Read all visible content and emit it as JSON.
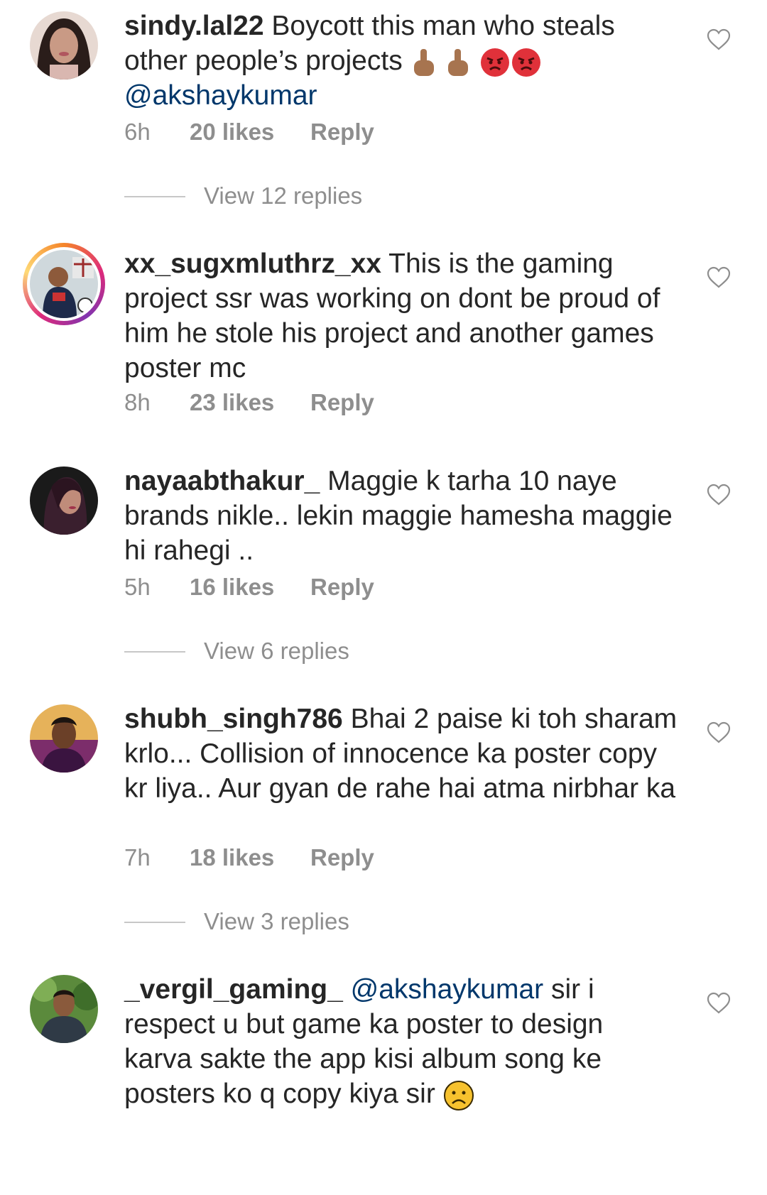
{
  "comments": [
    {
      "username": "sindy.lal22",
      "mention": "",
      "text": "Boycott this man who steals other people’s projects",
      "mention_after": "@akshaykumar",
      "time": "6h",
      "likes": "20 likes",
      "reply": "Reply",
      "view_replies": "View 12 replies"
    },
    {
      "username": "xx_sugxmluthrz_xx",
      "mention": "",
      "text": "This is the gaming project ssr was working on dont be proud of him he stole his project and another games poster mc",
      "time": "8h",
      "likes": "23 likes",
      "reply": "Reply",
      "view_replies": ""
    },
    {
      "username": "nayaabthakur_",
      "mention": "",
      "text": "Maggie k tarha 10 naye brands nikle.. lekin maggie hamesha maggie hi rahegi ..",
      "time": "5h",
      "likes": "16 likes",
      "reply": "Reply",
      "view_replies": "View 6 replies"
    },
    {
      "username": "shubh_singh786",
      "mention": "",
      "text": "Bhai 2 paise ki toh sharam krlo... Collision of innocence ka poster copy kr liya.. Aur gyan de rahe hai atma nirbhar ka",
      "time": "7h",
      "likes": "18 likes",
      "reply": "Reply",
      "view_replies": "View 3 replies"
    },
    {
      "username": "_vergil_gaming_",
      "mention": "@akshaykumar",
      "text": "sir i respect u but game ka poster to design karva sakte the app kisi album song ke posters ko q copy kiya sir",
      "time": "",
      "likes": "",
      "reply": "",
      "view_replies": ""
    }
  ],
  "icons": {
    "like": "heart-outline-icon",
    "emoji_1": "middle-finger-emoji",
    "emoji_2": "angry-face-emoji",
    "emoji_3": "frowning-face-emoji"
  },
  "colors": {
    "text": "#262626",
    "secondary": "#8e8e8e",
    "mention": "#00376b",
    "angry": "#e0313a",
    "frown": "#f7c22e"
  }
}
